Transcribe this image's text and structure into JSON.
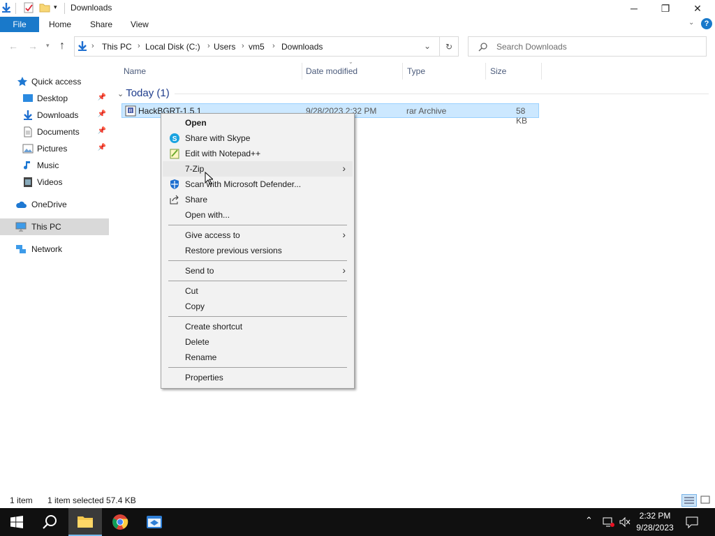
{
  "window": {
    "title": "Downloads",
    "buttons": {
      "minimize": "─",
      "restore": "❐",
      "close": "✕"
    }
  },
  "ribbon": {
    "file": "File",
    "tabs": [
      "Home",
      "Share",
      "View"
    ],
    "help": "?"
  },
  "address": {
    "crumbs": [
      "This PC",
      "Local Disk (C:)",
      "Users",
      "vm5",
      "Downloads"
    ],
    "search_placeholder": "Search Downloads"
  },
  "sidebar": {
    "items": [
      {
        "label": "Quick access",
        "icon": "star-icon",
        "pinned": false
      },
      {
        "label": "Desktop",
        "icon": "desktop-icon",
        "pinned": true
      },
      {
        "label": "Downloads",
        "icon": "download-icon",
        "pinned": true
      },
      {
        "label": "Documents",
        "icon": "document-icon",
        "pinned": true
      },
      {
        "label": "Pictures",
        "icon": "picture-icon",
        "pinned": true
      },
      {
        "label": "Music",
        "icon": "music-icon",
        "pinned": false
      },
      {
        "label": "Videos",
        "icon": "video-icon",
        "pinned": false
      },
      {
        "label": "OneDrive",
        "icon": "cloud-icon",
        "pinned": false
      },
      {
        "label": "This PC",
        "icon": "computer-icon",
        "pinned": false
      },
      {
        "label": "Network",
        "icon": "network-icon",
        "pinned": false
      }
    ]
  },
  "columns": [
    "Name",
    "Date modified",
    "Type",
    "Size"
  ],
  "group": "Today (1)",
  "file": {
    "name": "HackBGRT-1.5.1",
    "date": "9/28/2023 2:32 PM",
    "type": "rar Archive",
    "size": "58 KB"
  },
  "context_menu": {
    "items": [
      "Open",
      "Share with Skype",
      "Edit with Notepad++",
      "7-Zip",
      "Scan with Microsoft Defender...",
      "Share",
      "Open with...",
      "Give access to",
      "Restore previous versions",
      "Send to",
      "Cut",
      "Copy",
      "Create shortcut",
      "Delete",
      "Rename",
      "Properties"
    ]
  },
  "status": {
    "count": "1 item",
    "selection": "1 item selected  57.4 KB"
  },
  "taskbar": {
    "time": "2:32 PM",
    "date": "9/28/2023"
  },
  "colors": {
    "accent": "#1979ca",
    "selection": "#cce8ff",
    "taskbar": "#101010"
  }
}
